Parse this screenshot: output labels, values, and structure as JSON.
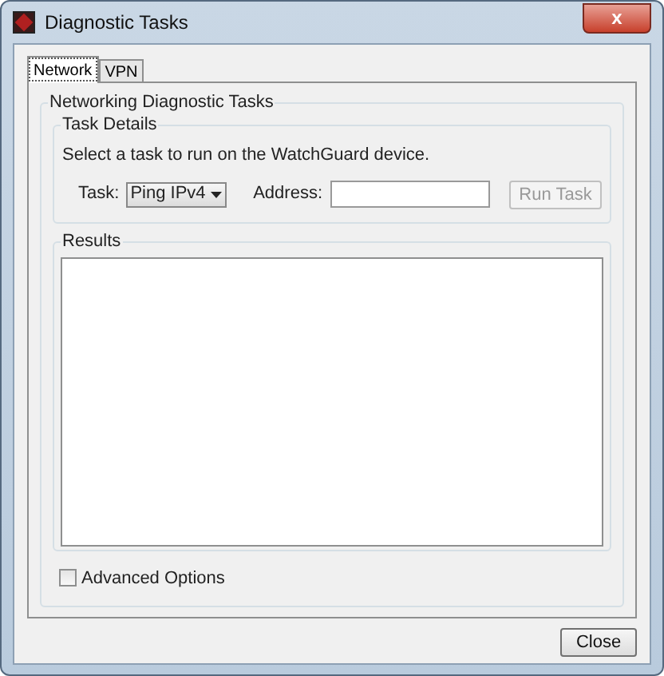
{
  "window": {
    "title": "Diagnostic Tasks",
    "close_glyph": "x"
  },
  "tabs": [
    {
      "label": "Network",
      "selected": true
    },
    {
      "label": "VPN",
      "selected": false
    }
  ],
  "group": {
    "title": "Networking Diagnostic Tasks",
    "task_details": {
      "title": "Task Details",
      "instruction": "Select a task to run on the WatchGuard device.",
      "task_label": "Task:",
      "task_value": "Ping IPv4",
      "address_label": "Address:",
      "run_button": {
        "label": "Run Task",
        "disabled": true
      }
    },
    "results": {
      "title": "Results"
    },
    "advanced_options": {
      "label": "Advanced Options",
      "checked": false
    }
  },
  "buttons": [
    {
      "label": "Close"
    }
  ]
}
